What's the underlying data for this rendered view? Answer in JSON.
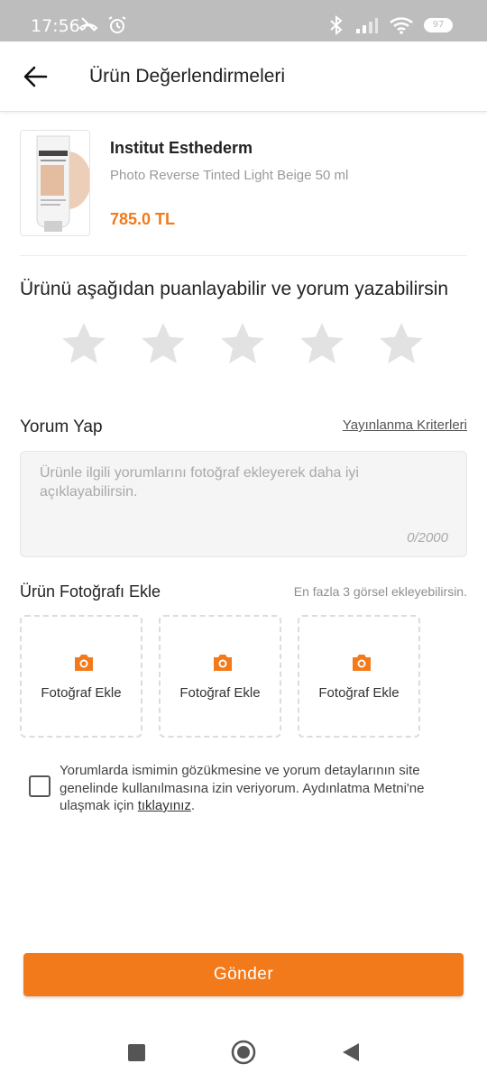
{
  "status_bar": {
    "time": "17:56",
    "battery": "97"
  },
  "header": {
    "title": "Ürün Değerlendirmeleri"
  },
  "product": {
    "brand": "Institut Esthederm",
    "name": "Photo Reverse Tinted Light Beige 50 ml",
    "price": "785.0 TL"
  },
  "rating": {
    "title": "Ürünü aşağıdan puanlayabilir ve yorum yazabilirsin",
    "max_stars": 5,
    "selected": 0
  },
  "comment": {
    "label": "Yorum Yap",
    "criteria_link": "Yayınlanma Kriterleri",
    "placeholder": "Ürünle ilgili yorumlarını fotoğraf ekleyerek daha iyi açıklayabilirsin.",
    "counter": "0/2000"
  },
  "photos": {
    "label": "Ürün Fotoğrafı Ekle",
    "hint": "En fazla 3 görsel ekleyebilirsin.",
    "slots": [
      "Fotoğraf Ekle",
      "Fotoğraf Ekle",
      "Fotoğraf Ekle"
    ]
  },
  "consent": {
    "text": "Yorumlarda ismimin gözükmesine ve yorum detaylarının site genelinde kullanılmasına izin veriyorum. Aydınlatma Metni'ne ulaşmak için ",
    "link": "tıklayınız",
    "suffix": ".",
    "checked": false
  },
  "submit": {
    "label": "Gönder"
  },
  "colors": {
    "accent": "#f27a1a",
    "star_empty": "#e2e2e2",
    "status_bar": "#bdbdbd"
  }
}
